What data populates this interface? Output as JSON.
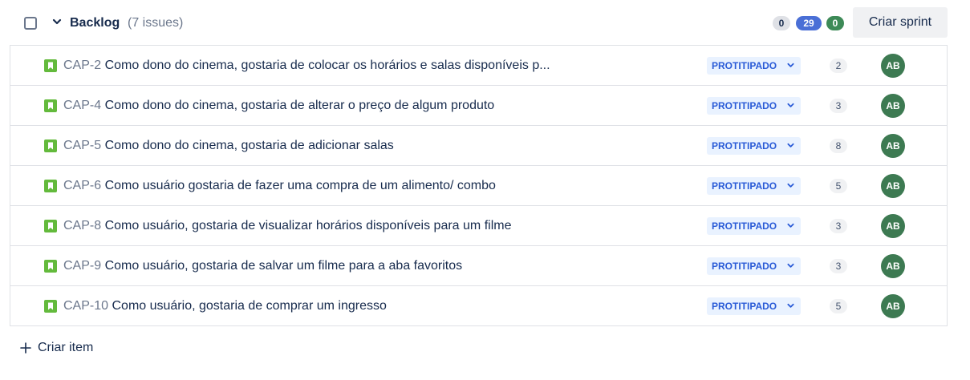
{
  "backlog": {
    "title": "Backlog",
    "issue_count": "(7 issues)",
    "badges": {
      "todo": "0",
      "in_progress": "29",
      "done": "0"
    },
    "create_sprint_label": "Criar sprint",
    "create_item_label": "Criar item"
  },
  "issues": [
    {
      "key": "CAP-2",
      "summary": "Como dono do cinema, gostaria de colocar os horários e salas disponíveis p...",
      "status": "PROTITIPADO",
      "points": "2",
      "assignee": "AB"
    },
    {
      "key": "CAP-4",
      "summary": "Como dono do cinema, gostaria de alterar o preço de algum produto",
      "status": "PROTITIPADO",
      "points": "3",
      "assignee": "AB"
    },
    {
      "key": "CAP-5",
      "summary": "Como dono do cinema, gostaria de adicionar salas",
      "status": "PROTITIPADO",
      "points": "8",
      "assignee": "AB"
    },
    {
      "key": "CAP-6",
      "summary": "Como usuário gostaria de fazer uma compra de um alimento/ combo",
      "status": "PROTITIPADO",
      "points": "5",
      "assignee": "AB"
    },
    {
      "key": "CAP-8",
      "summary": "Como usuário, gostaria de visualizar horários disponíveis para um filme",
      "status": "PROTITIPADO",
      "points": "3",
      "assignee": "AB"
    },
    {
      "key": "CAP-9",
      "summary": "Como usuário, gostaria de salvar um filme para a aba favoritos",
      "status": "PROTITIPADO",
      "points": "3",
      "assignee": "AB"
    },
    {
      "key": "CAP-10",
      "summary": "Como usuário, gostaria de comprar um ingresso",
      "status": "PROTITIPADO",
      "points": "5",
      "assignee": "AB"
    }
  ],
  "icons": {
    "story": "story-bookmark-icon",
    "status_arrow": "chevron-down-icon",
    "collapse": "chevron-down-icon",
    "create": "plus-icon"
  },
  "colors": {
    "story_icon": "#63ba3c",
    "status_bg": "#e9f2ff",
    "status_text": "#2a5bd7",
    "avatar": "#3d7a52",
    "badge_progress": "#4a6fd6",
    "badge_done": "#3d8a57"
  }
}
